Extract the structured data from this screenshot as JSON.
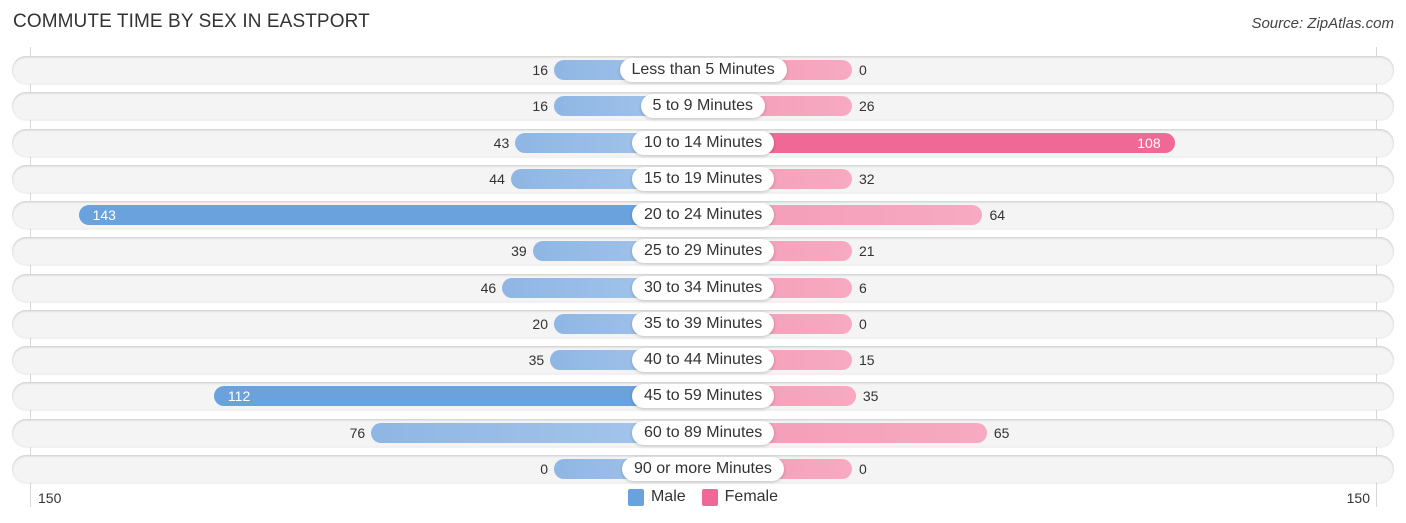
{
  "header": {
    "title": "COMMUTE TIME BY SEX IN EASTPORT",
    "source": "Source: ZipAtlas.com"
  },
  "colors": {
    "male": "#6aa2dd",
    "male_light": "#a0c2ea",
    "female": "#f06996",
    "female_light": "#f7a8c0",
    "row_bg": "#f4f4f4"
  },
  "chart_data": {
    "type": "bar",
    "orientation": "horizontal-diverging",
    "title": "COMMUTE TIME BY SEX IN EASTPORT",
    "categories": [
      "Less than 5 Minutes",
      "5 to 9 Minutes",
      "10 to 14 Minutes",
      "15 to 19 Minutes",
      "20 to 24 Minutes",
      "25 to 29 Minutes",
      "30 to 34 Minutes",
      "35 to 39 Minutes",
      "40 to 44 Minutes",
      "45 to 59 Minutes",
      "60 to 89 Minutes",
      "90 or more Minutes"
    ],
    "series": [
      {
        "name": "Male",
        "values": [
          16,
          16,
          43,
          44,
          143,
          39,
          46,
          20,
          35,
          112,
          76,
          0
        ]
      },
      {
        "name": "Female",
        "values": [
          0,
          26,
          108,
          32,
          64,
          21,
          6,
          0,
          15,
          35,
          65,
          0
        ]
      }
    ],
    "axis": {
      "left_tick": "150",
      "right_tick": "150",
      "range": [
        -150,
        150
      ]
    },
    "legend": {
      "position": "bottom-center",
      "entries": [
        "Male",
        "Female"
      ]
    },
    "xlabel": "",
    "ylabel": ""
  }
}
